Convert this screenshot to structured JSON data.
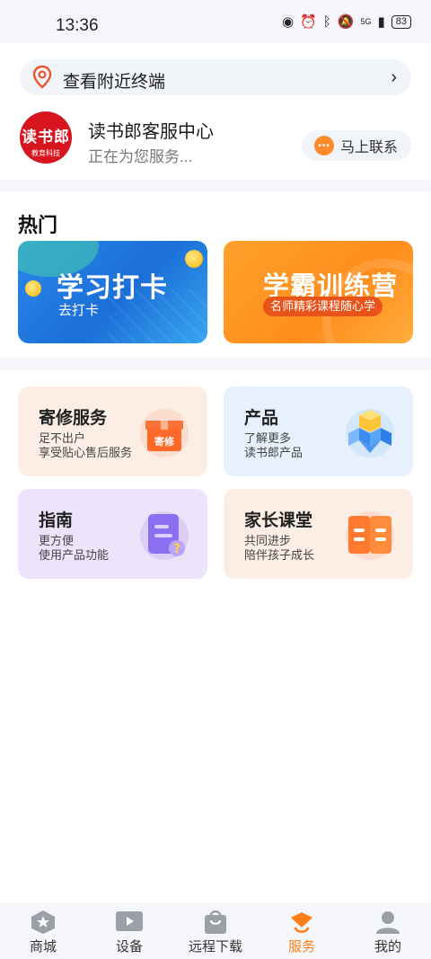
{
  "status_bar": {
    "time": "13:36",
    "network": "5G",
    "battery": "83"
  },
  "nearby": {
    "label": "查看附近终端"
  },
  "service_center": {
    "logo_main": "读书郎",
    "logo_sub": "教育科技",
    "title": "读书郎客服中心",
    "subtitle": "正在为您服务...",
    "contact_label": "马上联系"
  },
  "hot": {
    "title": "热门",
    "banners": [
      {
        "title": "学习打卡",
        "subtitle": "去打卡"
      },
      {
        "title": "学霸训练营",
        "subtitle": "名师精彩课程随心学"
      }
    ]
  },
  "services": [
    {
      "title": "寄修服务",
      "line1": "足不出户",
      "line2": "享受贴心售后服务",
      "icon_text": "寄修"
    },
    {
      "title": "产品",
      "line1": "了解更多",
      "line2": "读书郎产品"
    },
    {
      "title": "指南",
      "line1": "更方便",
      "line2": "使用产品功能"
    },
    {
      "title": "家长课堂",
      "line1": "共同进步",
      "line2": "陪伴孩子成长"
    }
  ],
  "tabbar": {
    "items": [
      {
        "label": "商城"
      },
      {
        "label": "设备"
      },
      {
        "label": "远程下载"
      },
      {
        "label": "服务"
      },
      {
        "label": "我的"
      }
    ],
    "active": "服务"
  },
  "colors": {
    "accent": "#ff7d1a",
    "logo_red": "#d7151f",
    "banner_blue": "#1b6fd8",
    "banner_orange": "#ff8d1c"
  }
}
